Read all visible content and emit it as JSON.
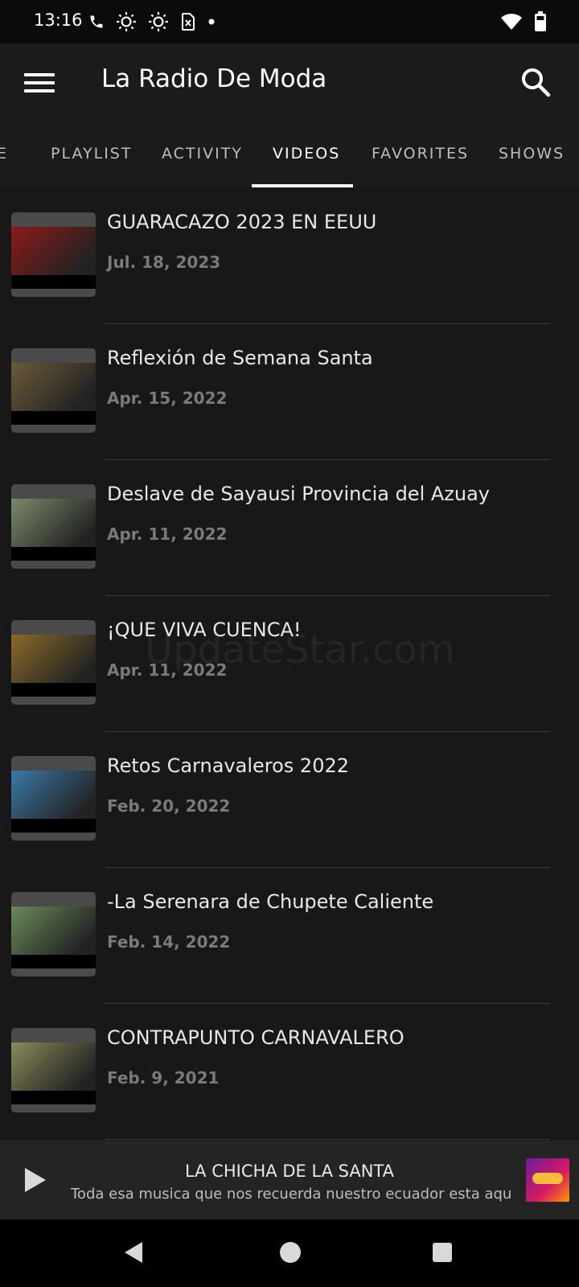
{
  "status_bar": {
    "time": "13:16",
    "icons_left": [
      "phone-icon",
      "brightness-icon",
      "brightness-icon",
      "sim-card-icon",
      "dot-icon"
    ],
    "icons_right": [
      "wifi-icon",
      "battery-icon"
    ]
  },
  "app_bar": {
    "title": "La Radio De Moda",
    "menu_icon": "menu-icon",
    "search_icon": "search-icon"
  },
  "tabs": [
    {
      "label": "E",
      "active": false
    },
    {
      "label": "PLAYLIST",
      "active": false
    },
    {
      "label": "ACTIVITY",
      "active": false
    },
    {
      "label": "VIDEOS",
      "active": true
    },
    {
      "label": "FAVORITES",
      "active": false
    },
    {
      "label": "SHOWS",
      "active": false
    }
  ],
  "videos": [
    {
      "title": "GUARACAZO 2023 EN EEUU",
      "date": "Jul. 18, 2023",
      "thumb_color": "#8b1a1a"
    },
    {
      "title": "Reflexión de Semana Santa",
      "date": "Apr. 15, 2022",
      "thumb_color": "#6b5a3a"
    },
    {
      "title": "Deslave de Sayausi Provincia del Azuay",
      "date": "Apr. 11, 2022",
      "thumb_color": "#7a8a6a"
    },
    {
      "title": "¡QUE VIVA CUENCA!",
      "date": "Apr. 11, 2022",
      "thumb_color": "#8a6a2a"
    },
    {
      "title": "Retos Carnavaleros 2022",
      "date": "Feb. 20, 2022",
      "thumb_color": "#3a7aa8"
    },
    {
      "title": "-La Serenara de Chupete Caliente",
      "date": "Feb. 14, 2022",
      "thumb_color": "#6a8a5a"
    },
    {
      "title": "CONTRAPUNTO CARNAVALERO",
      "date": "Feb. 9, 2021",
      "thumb_color": "#8a8a5a"
    }
  ],
  "watermark": "UpdateStar.com",
  "player": {
    "title": "LA CHICHA DE LA SANTA",
    "subtitle": "Toda esa musica que nos recuerda nuestro ecuador esta aqui",
    "play_icon": "play-icon"
  },
  "nav_bar": {
    "icons": [
      "back-icon",
      "home-icon",
      "recent-apps-icon"
    ]
  }
}
